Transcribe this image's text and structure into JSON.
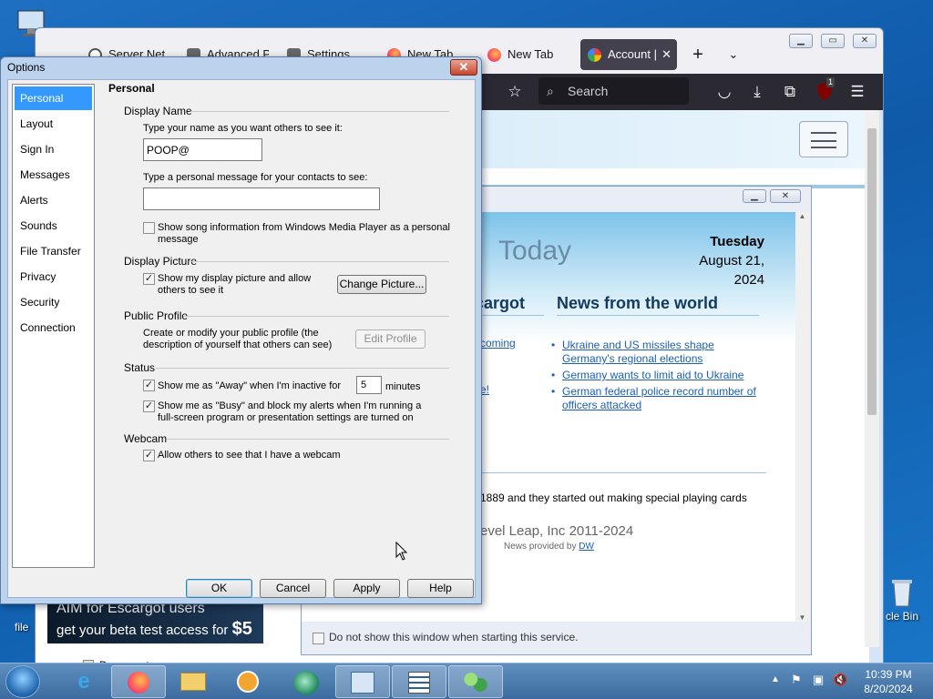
{
  "desktop": {
    "icons": [
      {
        "label": "file",
        "icon": "computer-icon"
      },
      {
        "label": "cle Bin",
        "icon": "recycle-bin-icon"
      }
    ]
  },
  "browser": {
    "tabs": [
      {
        "label": "Server Net F",
        "icon": "globe-icon"
      },
      {
        "label": "Advanced P",
        "icon": "gear-icon"
      },
      {
        "label": "Settings",
        "icon": "gear-icon"
      },
      {
        "label": "New Tab",
        "icon": "firefox-icon"
      },
      {
        "label": "New Tab",
        "icon": "firefox-icon"
      },
      {
        "label": "Account |",
        "icon": "google-icon",
        "active": true
      }
    ],
    "new_tab_symbol": "+",
    "search_placeholder": "Search",
    "notification_badge": "1",
    "below_dialog_item": "Documents"
  },
  "today": {
    "heading_partial": "t",
    "heading_today": "Today",
    "date": {
      "weekday": "Tuesday",
      "month_day": "August 21,",
      "year": "2024"
    },
    "left_col_title": "cargot",
    "left_col_link1": "coming",
    "left_col_link2": "e!",
    "world_title": "News from the world",
    "news": [
      "Ukraine and US missiles shape Germany's regional elections",
      "Germany wants to limit aid to Ukraine",
      "German federal police record number of officers attacked"
    ],
    "trivia": "1889 and they started out making special playing cards",
    "copyright": "evel Leap, Inc 2011-2024",
    "provided_by_prefix": "News provided by",
    "provided_by_link": "DW",
    "dont_show_label": "Do not show this window when starting this service.",
    "ad_line1": "AIM for Escargot users",
    "ad_line2_prefix": "get your beta test access for",
    "ad_price": "$5"
  },
  "dialog": {
    "title": "Options",
    "close_symbol": "✕",
    "nav": [
      "Personal",
      "Layout",
      "Sign In",
      "Messages",
      "Alerts",
      "Sounds",
      "File Transfer",
      "Privacy",
      "Security",
      "Connection"
    ],
    "selected_nav": "Personal",
    "page_title": "Personal",
    "display_name": {
      "section": "Display Name",
      "name_label": "Type your name as you want others to see it:",
      "name_value": "POOP@",
      "message_label": "Type a personal message for your contacts to see:",
      "message_value": "",
      "song_label_1": "Show song information from Windows Media Player as a personal",
      "song_label_2": "message",
      "song_checked": false
    },
    "display_picture": {
      "section": "Display Picture",
      "show_label_1": "Show my display picture and allow",
      "show_label_2": "others to see it",
      "show_checked": true,
      "change_button": "Change Picture..."
    },
    "public_profile": {
      "section": "Public Profile",
      "desc_1": "Create or modify your public profile (the",
      "desc_2": "description of yourself that others can see)",
      "edit_button": "Edit Profile"
    },
    "status": {
      "section": "Status",
      "away_label": "Show me as \"Away\" when I'm inactive for",
      "away_checked": true,
      "away_minutes": "5",
      "minutes_label": "minutes",
      "busy_label_1": "Show me as \"Busy\" and block my alerts when I'm running a",
      "busy_label_2": "full-screen program or presentation settings are turned on",
      "busy_checked": true
    },
    "webcam": {
      "section": "Webcam",
      "label": "Allow others to see that I have a webcam",
      "checked": true
    },
    "buttons": {
      "ok": "OK",
      "cancel": "Cancel",
      "apply": "Apply",
      "help": "Help"
    }
  },
  "taskbar": {
    "time": "10:39 PM",
    "date": "8/20/2024",
    "apps": [
      "start-orb-icon",
      "internet-explorer-icon",
      "firefox-icon",
      "file-explorer-icon",
      "media-player-icon",
      "escargot-messenger-icon",
      "control-panel-icon",
      "notepad-list-icon",
      "messenger-contacts-icon"
    ]
  },
  "colors": {
    "accent": "#3399ff",
    "link": "#1a5fb4",
    "desktop": "#1566b8",
    "taskbar": "#4a79ab"
  }
}
